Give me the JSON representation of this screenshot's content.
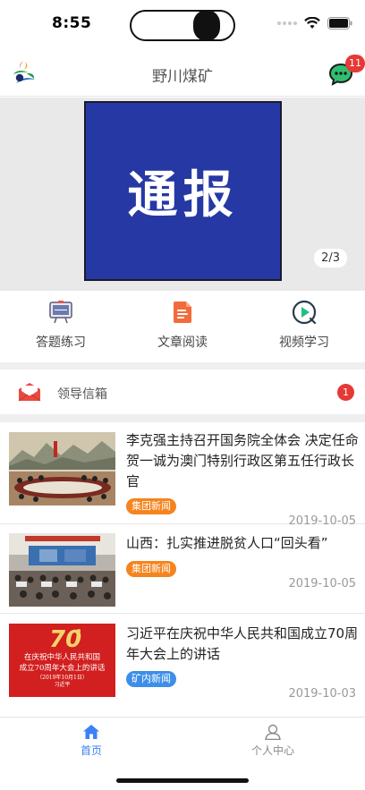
{
  "status": {
    "time": "8:55"
  },
  "header": {
    "title": "野川煤矿",
    "message_badge": "11"
  },
  "banner": {
    "image_text": "通报",
    "indicator": "2/3"
  },
  "quick_menu": [
    {
      "label": "答题练习",
      "icon": "exam-board-icon"
    },
    {
      "label": "文章阅读",
      "icon": "document-icon"
    },
    {
      "label": "视频学习",
      "icon": "play-icon"
    }
  ],
  "mailbox": {
    "label": "领导信箱",
    "badge": "1"
  },
  "news": [
    {
      "title": "李克强主持召开国务院全体会 决定任命贺一诚为澳门特别行政区第五任行政长官",
      "tag": "集团新闻",
      "date": "2019-10-05"
    },
    {
      "title": "山西：扎实推进脱贫人口“回头看”",
      "tag": "集团新闻",
      "date": "2019-10-05"
    },
    {
      "title": "习近平在庆祝中华人民共和国成立70周年大会上的讲话",
      "tag": "矿内新闻",
      "date": "2019-10-03"
    }
  ],
  "thumb3": {
    "line1": "在庆祝中华人民共和国",
    "line2": "成立70周年大会上的讲话",
    "line3": "（2019年10月1日）",
    "line4": "习近平"
  },
  "tabs": [
    {
      "label": "首页"
    },
    {
      "label": "个人中心"
    }
  ],
  "colors": {
    "accent": "#3b82f6",
    "tag_group": "#f5841f",
    "tag_mine": "#3d8ee8",
    "badge": "#e53935",
    "banner": "#2638a3"
  }
}
